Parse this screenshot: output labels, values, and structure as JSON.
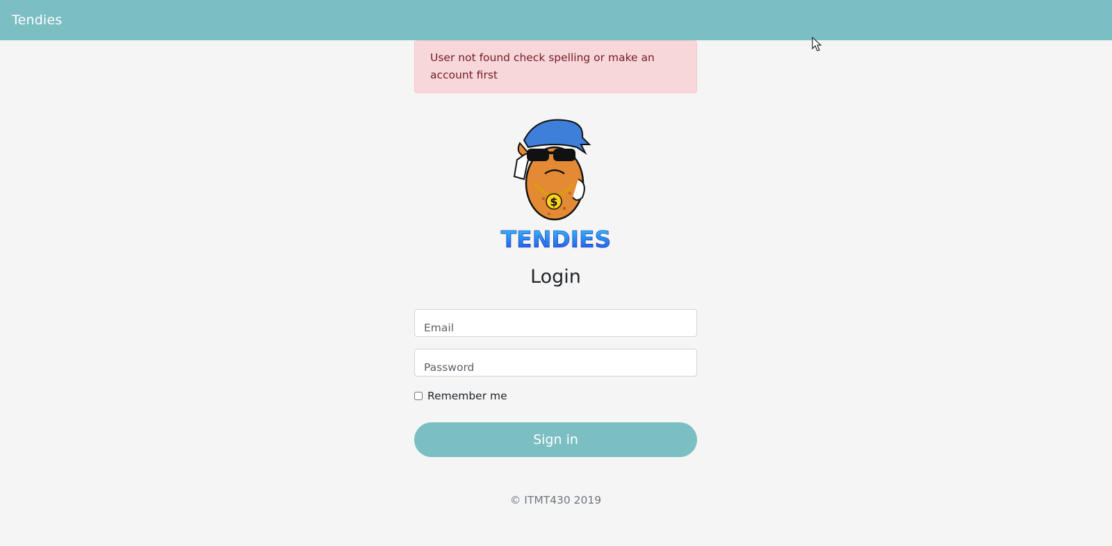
{
  "navbar": {
    "brand": "Tendies"
  },
  "alert": {
    "message": "User not found check spelling or make an account first"
  },
  "logo": {
    "text": "TENDIES",
    "icon": "tendies-mascot-logo"
  },
  "login": {
    "title": "Login",
    "email_placeholder": "Email",
    "password_placeholder": "Password",
    "remember_label": "Remember me",
    "signin_label": "Sign in"
  },
  "footer": {
    "text": "© ITMT430 2019"
  },
  "colors": {
    "navbar": "#7bbfc3",
    "button": "#7bbfc3",
    "alert_bg": "#f8d7da",
    "alert_text": "#721c24",
    "page_bg": "#f5f5f5"
  }
}
